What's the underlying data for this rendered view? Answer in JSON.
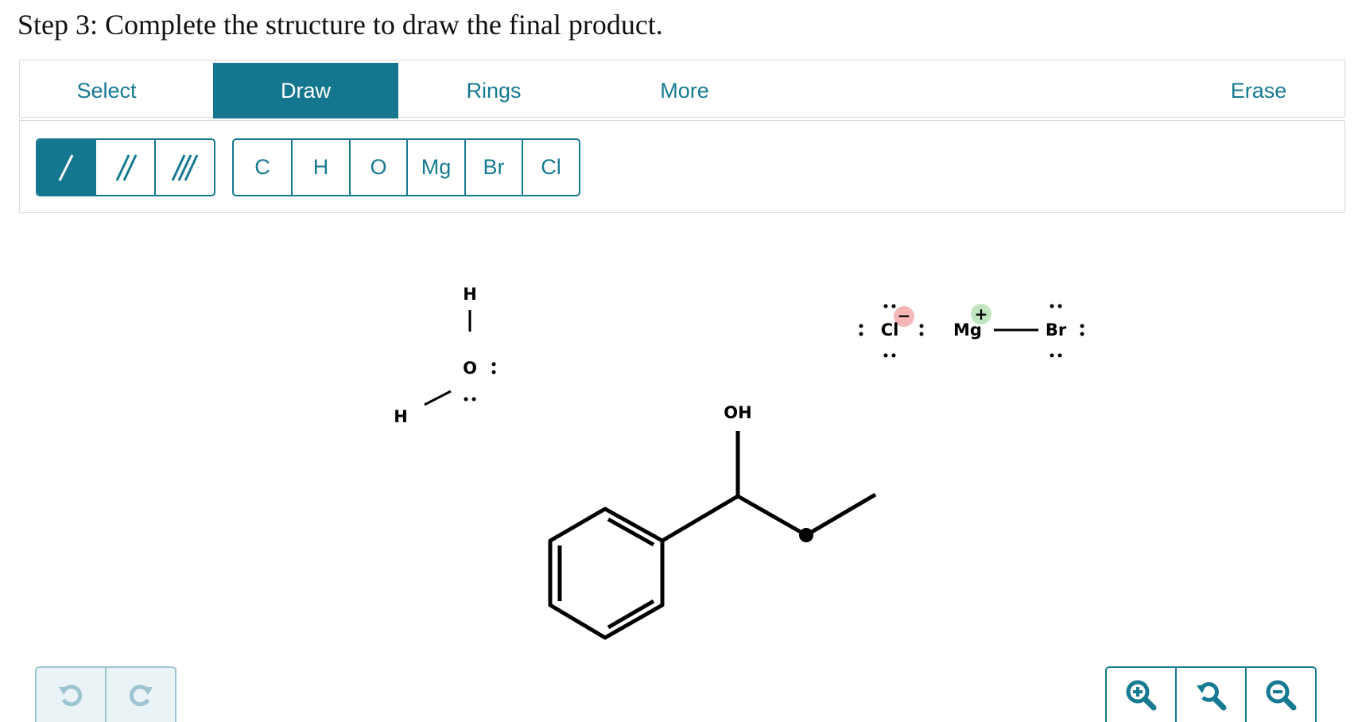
{
  "step_title": "Step 3: Complete the structure to draw the final product.",
  "tabs": {
    "select": "Select",
    "draw": "Draw",
    "rings": "Rings",
    "more": "More",
    "erase": "Erase"
  },
  "bond_tools": [
    {
      "name": "single-bond",
      "icon": "single-bond-icon",
      "active": true
    },
    {
      "name": "double-bond",
      "icon": "double-bond-icon",
      "active": false
    },
    {
      "name": "triple-bond",
      "icon": "triple-bond-icon",
      "active": false
    }
  ],
  "atoms": [
    "C",
    "H",
    "O",
    "Mg",
    "Br",
    "Cl"
  ],
  "molecule_labels": {
    "water_h_top": "H",
    "water_o": "O",
    "water_h_left": "H",
    "alcohol_oh": "OH",
    "chloride_cl": "Cl",
    "chloride_charge": "−",
    "magnesium": "Mg",
    "magnesium_charge": "+",
    "bromine": "Br"
  },
  "history": {
    "undo_icon": "undo-icon",
    "redo_icon": "redo-icon"
  },
  "zoom": {
    "zoom_in_icon": "zoom-in-icon",
    "reset_icon": "zoom-reset-icon",
    "zoom_out_icon": "zoom-out-icon"
  },
  "colors": {
    "accent": "#15778f",
    "minus_badge": "#f4b6b6",
    "plus_badge": "#bfe6bf"
  }
}
